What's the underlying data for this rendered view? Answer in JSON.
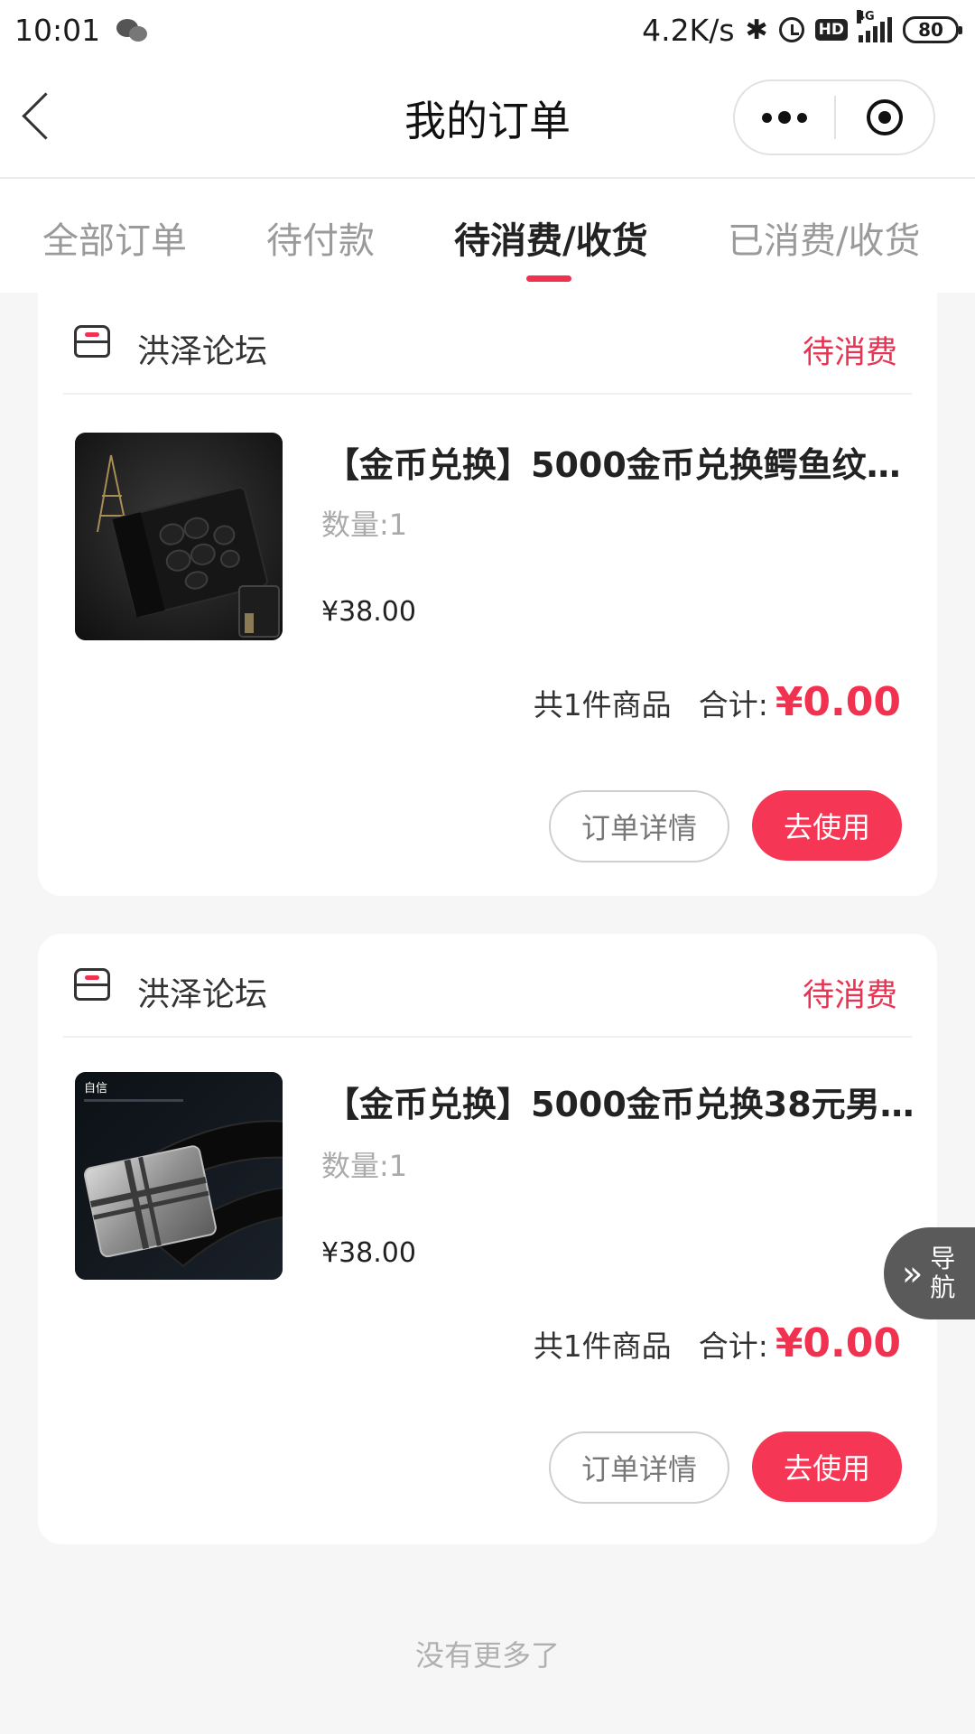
{
  "status_bar": {
    "time": "10:01",
    "net_speed": "4.2K/s",
    "signal": "4G",
    "battery": "80"
  },
  "nav": {
    "title": "我的订单"
  },
  "tabs": [
    {
      "label": "全部订单",
      "active": false
    },
    {
      "label": "待付款",
      "active": false
    },
    {
      "label": "待消费/收货",
      "active": true
    },
    {
      "label": "已消费/收货",
      "active": false
    }
  ],
  "orders": [
    {
      "shop": "洪泽论坛",
      "status": "待消费",
      "title": "【金币兑换】5000金币兑换鳄鱼纹…",
      "qty": "数量:1",
      "price": "¥38.00",
      "count": "共1件商品",
      "total_label": "合计:",
      "total": "¥0.00",
      "detail_btn": "订单详情",
      "use_btn": "去使用",
      "image": "crocodile-wallet"
    },
    {
      "shop": "洪泽论坛",
      "status": "待消费",
      "title": "【金币兑换】5000金币兑换38元男…",
      "qty": "数量:1",
      "price": "¥38.00",
      "count": "共1件商品",
      "total_label": "合计:",
      "total": "¥0.00",
      "detail_btn": "订单详情",
      "use_btn": "去使用",
      "image": "belt-buckle",
      "image_caption": "自信"
    }
  ],
  "float_nav": {
    "arrows": "»",
    "label": "导航"
  },
  "footer": {
    "no_more": "没有更多了"
  },
  "colors": {
    "accent": "#f0314f",
    "status_red": "#e83452",
    "button_red": "#f53655"
  }
}
